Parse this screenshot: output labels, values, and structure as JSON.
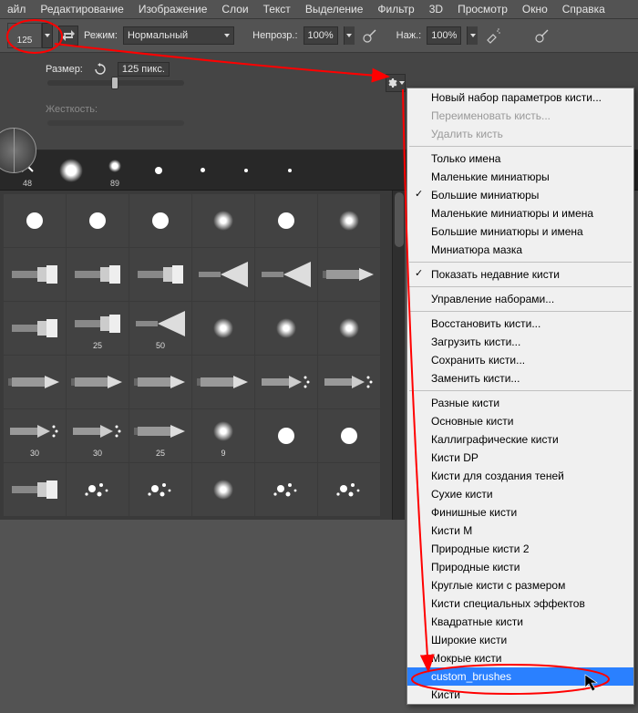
{
  "menubar": {
    "items": [
      "айл",
      "Редактирование",
      "Изображение",
      "Слои",
      "Текст",
      "Выделение",
      "Фильтр",
      "3D",
      "Просмотр",
      "Окно",
      "Справка"
    ]
  },
  "options": {
    "brush_size": "125",
    "mode_label": "Режим:",
    "mode_value": "Нормальный",
    "opacity_label": "Непрозр.:",
    "opacity_value": "100%",
    "flow_label": "Наж.:",
    "flow_value": "100%"
  },
  "brushSettings": {
    "size_label": "Размер:",
    "size_value": "125 пикс.",
    "hardness_label": "Жесткость:"
  },
  "presets": [
    {
      "label": "48",
      "dot_style": "x"
    },
    {
      "label": "",
      "dot_style": "big-soft"
    },
    {
      "label": "89",
      "dot_style": "medium"
    },
    {
      "label": "",
      "dot_style": "small"
    },
    {
      "label": "",
      "dot_style": "tiny"
    },
    {
      "label": "",
      "dot_style": "tiny"
    },
    {
      "label": "",
      "dot_style": "tiny"
    }
  ],
  "brush_grid_labels": [
    "",
    "",
    "",
    "",
    "",
    "",
    "",
    "",
    "",
    "",
    "",
    "",
    "",
    "25",
    "50",
    "",
    "",
    "",
    "",
    "",
    "",
    "",
    "",
    "",
    "30",
    "30",
    "25",
    "9",
    "",
    "",
    "",
    "",
    "",
    "",
    "",
    ""
  ],
  "context_menu": {
    "sections": [
      [
        {
          "label": "Новый набор параметров кисти...",
          "type": "item"
        },
        {
          "label": "Переименовать кисть...",
          "type": "disabled"
        },
        {
          "label": "Удалить кисть",
          "type": "disabled"
        }
      ],
      [
        {
          "label": "Только имена",
          "type": "item"
        },
        {
          "label": "Маленькие миниатюры",
          "type": "item"
        },
        {
          "label": "Большие миниатюры",
          "type": "checked"
        },
        {
          "label": "Маленькие миниатюры и имена",
          "type": "item"
        },
        {
          "label": "Большие миниатюры и имена",
          "type": "item"
        },
        {
          "label": "Миниатюра мазка",
          "type": "item"
        }
      ],
      [
        {
          "label": "Показать недавние кисти",
          "type": "checked"
        }
      ],
      [
        {
          "label": "Управление наборами...",
          "type": "item"
        }
      ],
      [
        {
          "label": "Восстановить кисти...",
          "type": "item"
        },
        {
          "label": "Загрузить кисти...",
          "type": "item"
        },
        {
          "label": "Сохранить кисти...",
          "type": "item"
        },
        {
          "label": "Заменить кисти...",
          "type": "item"
        }
      ],
      [
        {
          "label": "Разные кисти",
          "type": "item"
        },
        {
          "label": "Основные кисти",
          "type": "item"
        },
        {
          "label": "Каллиграфические кисти",
          "type": "item"
        },
        {
          "label": "Кисти DP",
          "type": "item"
        },
        {
          "label": "Кисти для создания теней",
          "type": "item"
        },
        {
          "label": "Сухие кисти",
          "type": "item"
        },
        {
          "label": "Финишные кисти",
          "type": "item"
        },
        {
          "label": "Кисти M",
          "type": "item"
        },
        {
          "label": "Природные кисти 2",
          "type": "item"
        },
        {
          "label": "Природные кисти",
          "type": "item"
        },
        {
          "label": "Круглые кисти с размером",
          "type": "item"
        },
        {
          "label": "Кисти специальных эффектов",
          "type": "item"
        },
        {
          "label": "Квадратные кисти",
          "type": "item"
        },
        {
          "label": "Широкие кисти",
          "type": "item"
        },
        {
          "label": "Мокрые кисти",
          "type": "item"
        },
        {
          "label": "custom_brushes",
          "type": "selected"
        },
        {
          "label": "Кисти",
          "type": "item"
        }
      ]
    ]
  }
}
